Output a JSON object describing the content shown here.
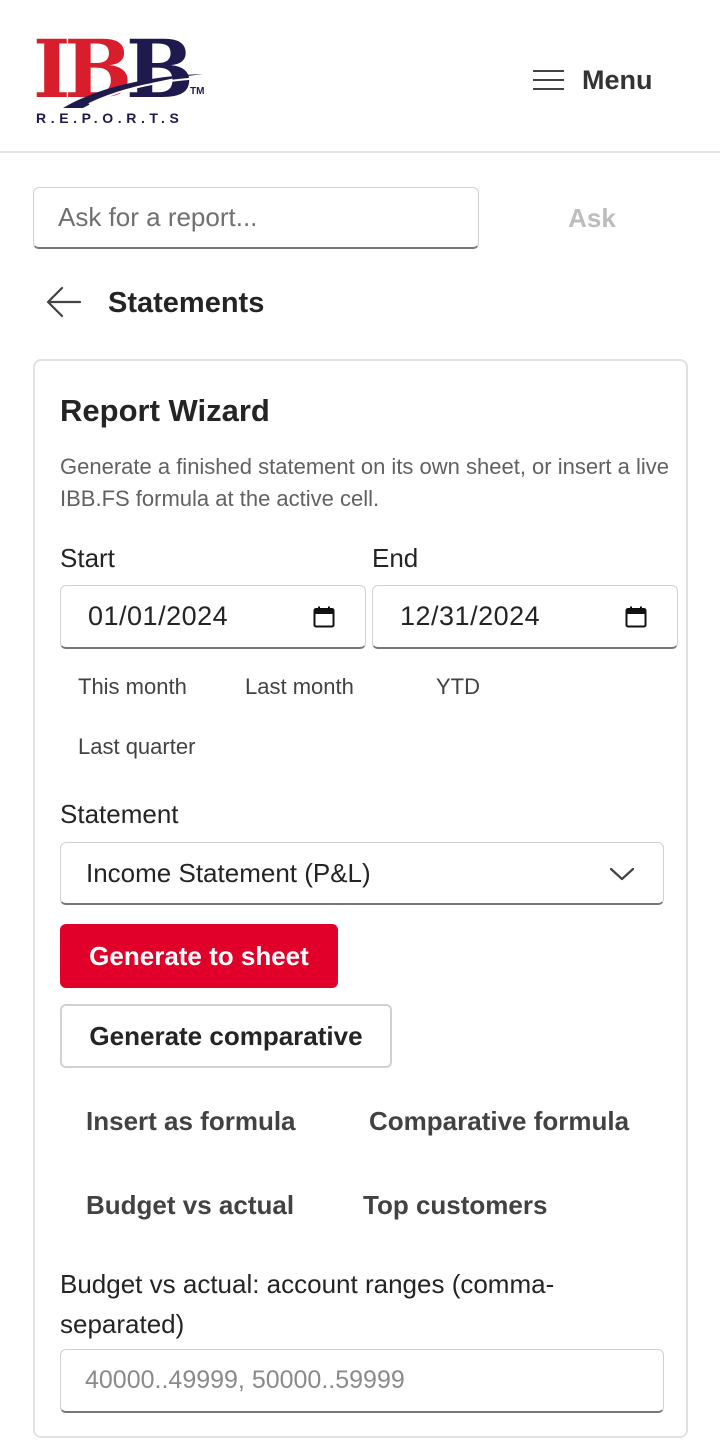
{
  "header": {
    "logo_text": "IBB",
    "logo_tm": "TM",
    "logo_sub": "R.E.P.O.R.T.S",
    "menu_label": "Menu",
    "menu_icon": "hamburger-icon"
  },
  "ask": {
    "placeholder": "Ask for a report...",
    "button_label": "Ask"
  },
  "nav": {
    "back_icon": "arrow-left-icon",
    "title": "Statements"
  },
  "wizard": {
    "title": "Report Wizard",
    "description": "Generate a finished statement on its own sheet, or insert a live IBB.FS formula at the active cell.",
    "start_label": "Start",
    "start_value": "01/01/2024",
    "end_label": "End",
    "end_value": "12/31/2024",
    "calendar_icon": "calendar-icon",
    "presets": [
      "This month",
      "Last month",
      "YTD",
      "Last quarter"
    ],
    "statement_label": "Statement",
    "statement_value": "Income Statement (P&L)",
    "chevron_icon": "chevron-down-icon",
    "generate_label": "Generate to sheet",
    "comparative_label": "Generate comparative",
    "insert_formula_label": "Insert as formula",
    "comparative_formula_label": "Comparative formula",
    "budget_vs_actual_label": "Budget vs actual",
    "top_customers_label": "Top customers",
    "ranges_label": "Budget vs actual: account ranges (comma-separated)",
    "ranges_placeholder": "40000..49999, 50000..59999"
  },
  "colors": {
    "brand_red": "#d81e2c",
    "brand_navy": "#1f1a4d",
    "primary_button": "#e0002a"
  }
}
